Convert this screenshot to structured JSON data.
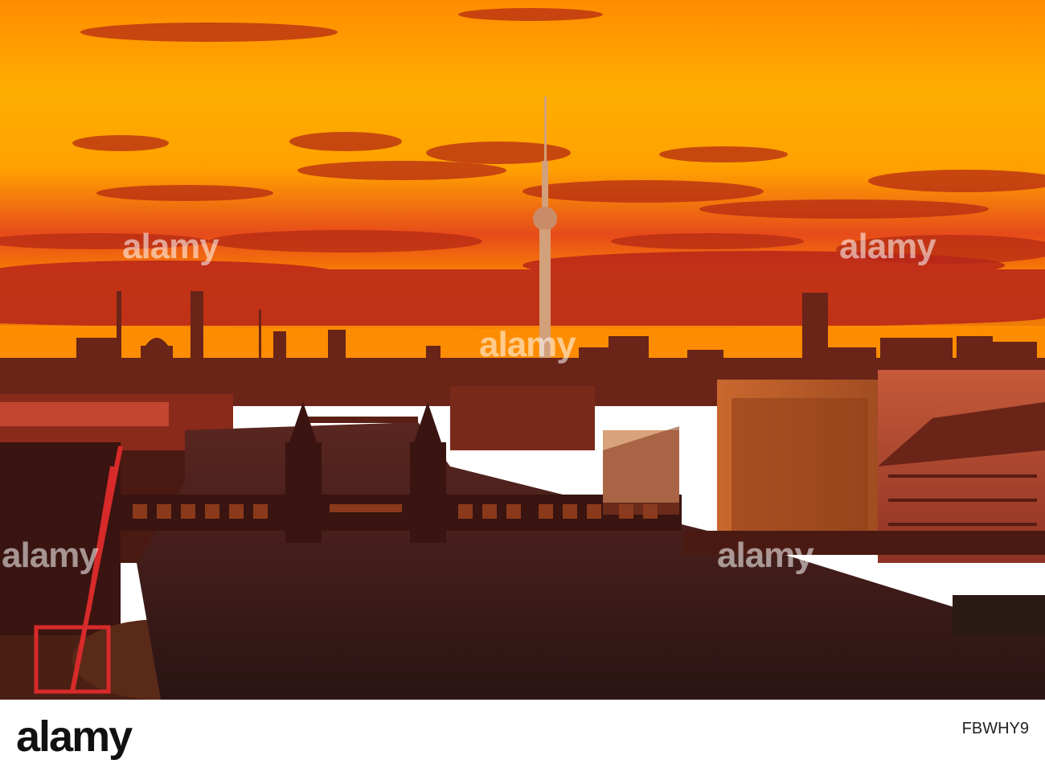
{
  "photo": {
    "colors": {
      "sky_top": "#ff8c00",
      "sky_mid": "#ffb300",
      "sky_low": "#ff7a00",
      "cloud_dark": "#a01818",
      "horizon_glow": "#ff9d00",
      "water": "#3a1b1b",
      "buildings": "#5a1a12",
      "warehouse": "#c05a2a"
    },
    "subject": "Berlin skyline with TV tower and Oberbaum Bridge at sunset"
  },
  "watermark": {
    "text": "alamy"
  },
  "footer": {
    "logo": "alamy",
    "image_id": "FBWHY9"
  }
}
